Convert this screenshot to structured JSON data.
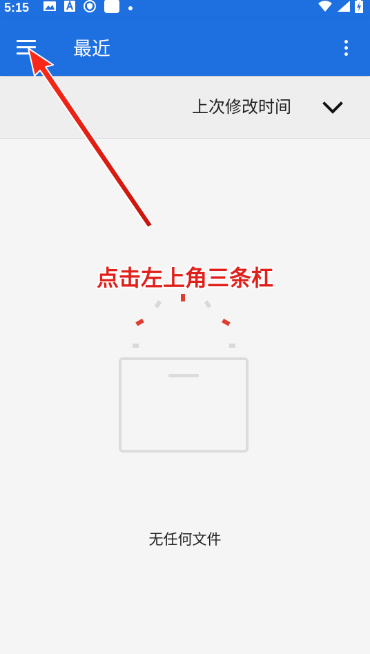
{
  "status_bar": {
    "time": "5:15",
    "icons_left": [
      "image-icon",
      "text-a-icon",
      "vpn-shield-icon",
      "blank-square-icon",
      "dot-icon"
    ],
    "icons_right": [
      "wifi-icon",
      "signal-icon",
      "battery-charging-icon"
    ]
  },
  "app_bar": {
    "menu_icon": "hamburger-menu-icon",
    "title": "最近",
    "overflow_icon": "more-vert-icon",
    "color": "#1e6fe0"
  },
  "sort_bar": {
    "label": "上次修改时间",
    "dropdown_icon": "chevron-down-icon"
  },
  "empty_state": {
    "illustration": "empty-box-icon",
    "message": "无任何文件"
  },
  "annotation": {
    "text": "点击左上角三条杠",
    "color": "#e0201b"
  }
}
